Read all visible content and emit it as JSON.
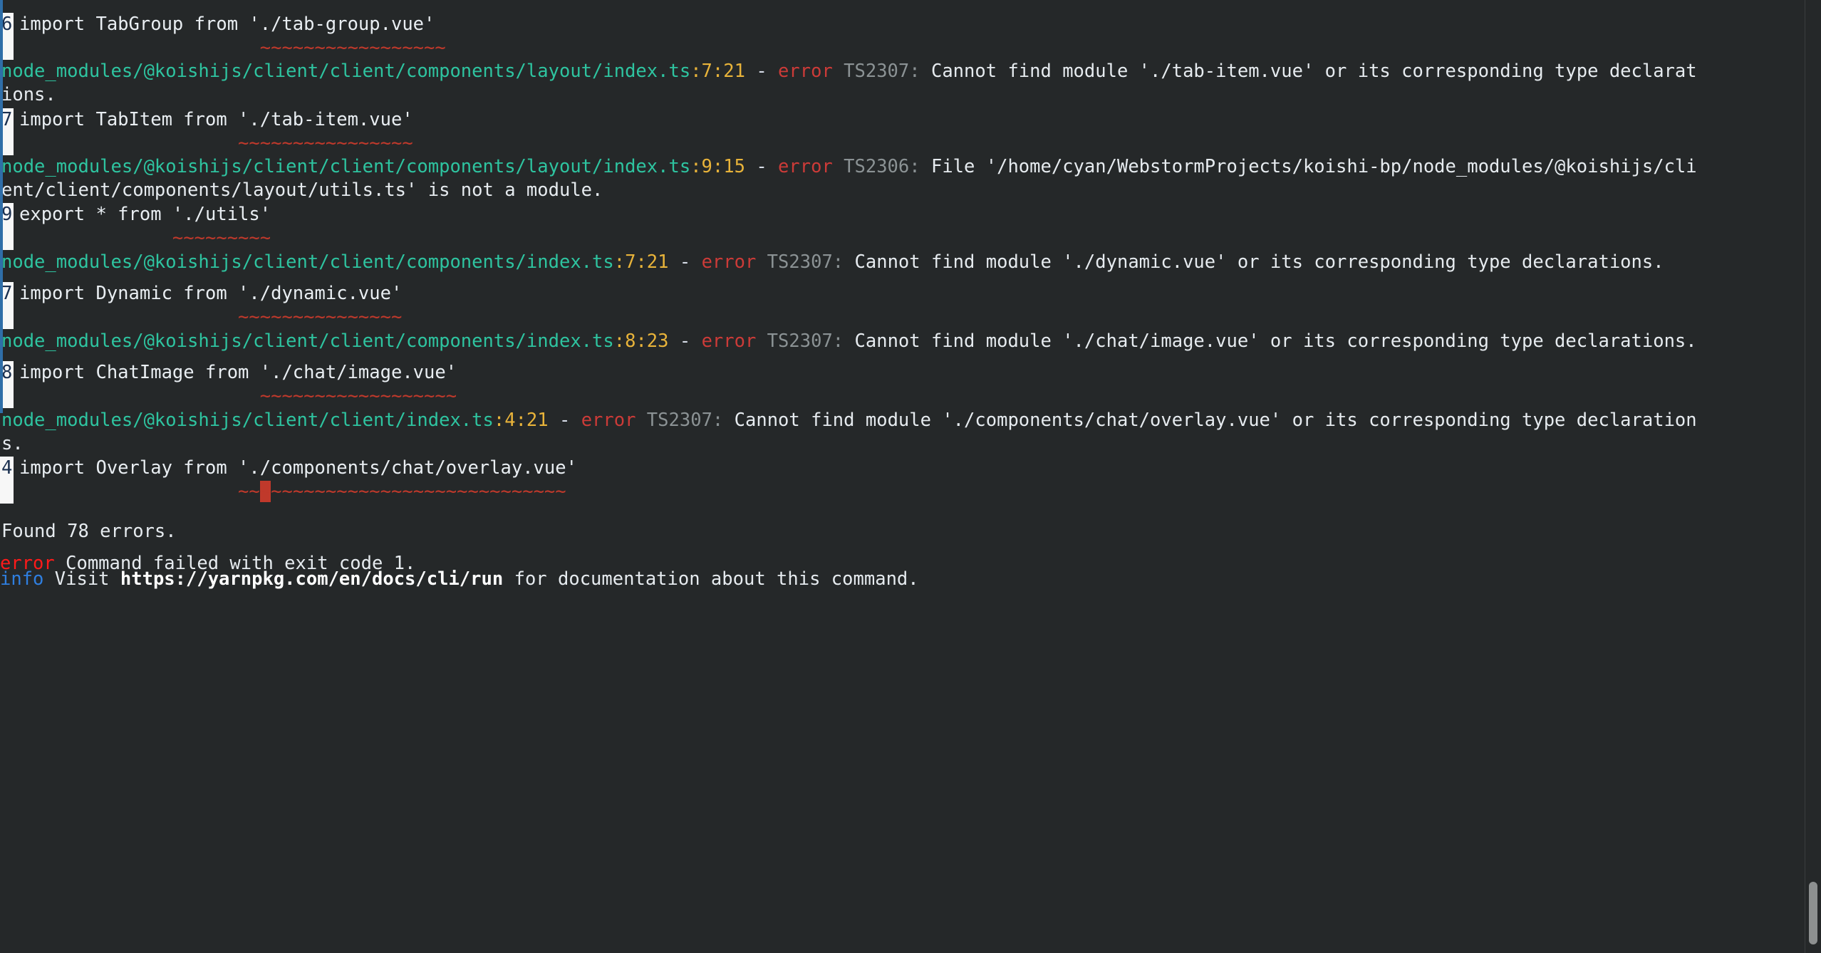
{
  "terminal": {
    "background_color": "#252829",
    "accent_strip_color": "#2f6ea8",
    "colors": {
      "path": "#2ec4a0",
      "position": "#e8b33a",
      "error_word": "#cc3b38",
      "error_code": "#8b9294",
      "message": "#e6ebef",
      "squiggle": "#c0392b",
      "gutter_bg": "#f7f7f7",
      "gutter_fg": "#1b3050",
      "yarn_error_tag": "#ff1a1a",
      "yarn_info_tag": "#2f7fe0"
    }
  },
  "entries": [
    {
      "id": "snippet-0",
      "kind": "snippet",
      "line_number": "6",
      "code": "import TabGroup from './tab-group.vue'",
      "squiggle": "                      ~~~~~~~~~~~~~~~~~",
      "cursor_index": -1
    },
    {
      "id": "diag-1",
      "kind": "diagnostic",
      "path": "node_modules/@koishijs/client/client/components/layout/index.ts",
      "position": ":7:21",
      "dash": " - ",
      "error_word": "error",
      "code": " TS2307:",
      "message": " Cannot find module './tab-item.vue' or its corresponding type declarat",
      "message_wrap": "ions."
    },
    {
      "id": "snippet-1",
      "kind": "snippet",
      "line_number": "7",
      "code": "import TabItem from './tab-item.vue'",
      "squiggle": "                    ~~~~~~~~~~~~~~~~",
      "cursor_index": -1
    },
    {
      "id": "diag-2",
      "kind": "diagnostic",
      "path": "node_modules/@koishijs/client/client/components/layout/index.ts",
      "position": ":9:15",
      "dash": " - ",
      "error_word": "error",
      "code": " TS2306:",
      "message": " File '/home/cyan/WebstormProjects/koishi-bp/node_modules/@koishijs/cli",
      "message_wrap": "ent/client/components/layout/utils.ts' is not a module."
    },
    {
      "id": "snippet-2",
      "kind": "snippet",
      "line_number": "9",
      "code": "export * from './utils'",
      "squiggle": "              ~~~~~~~~~",
      "cursor_index": -1
    },
    {
      "id": "diag-3",
      "kind": "diagnostic",
      "path": "node_modules/@koishijs/client/client/components/index.ts",
      "position": ":7:21",
      "dash": " - ",
      "error_word": "error",
      "code": " TS2307:",
      "message": " Cannot find module './dynamic.vue' or its corresponding type declarations.",
      "message_wrap": ""
    },
    {
      "id": "snippet-3",
      "kind": "snippet",
      "line_number": "7",
      "code": "import Dynamic from './dynamic.vue'",
      "squiggle": "                    ~~~~~~~~~~~~~~~",
      "cursor_index": -1
    },
    {
      "id": "diag-4",
      "kind": "diagnostic",
      "path": "node_modules/@koishijs/client/client/components/index.ts",
      "position": ":8:23",
      "dash": " - ",
      "error_word": "error",
      "code": " TS2307:",
      "message": " Cannot find module './chat/image.vue' or its corresponding type declarations.",
      "message_wrap": ""
    },
    {
      "id": "snippet-4",
      "kind": "snippet",
      "line_number": "8",
      "code": "import ChatImage from './chat/image.vue'",
      "squiggle": "                      ~~~~~~~~~~~~~~~~~~",
      "cursor_index": -1
    },
    {
      "id": "diag-5",
      "kind": "diagnostic",
      "path": "node_modules/@koishijs/client/client/index.ts",
      "position": ":4:21",
      "dash": " - ",
      "error_word": "error",
      "code": " TS2307:",
      "message": " Cannot find module './components/chat/overlay.vue' or its corresponding type declaration",
      "message_wrap": "s."
    },
    {
      "id": "snippet-5",
      "kind": "snippet",
      "line_number": "4",
      "code": "import Overlay from './components/chat/overlay.vue'",
      "squiggle": "                    ~~~~~~~~~~~~~~~~~~~~~~~~~~~~~~",
      "cursor_index": 22
    }
  ],
  "summary": {
    "found_errors": "Found 78 errors."
  },
  "yarn_output": {
    "error_tag": "error",
    "error_message": " Command failed with exit code 1.",
    "info_tag": "info",
    "info_prefix": " Visit ",
    "info_url": "https://yarnpkg.com/en/docs/cli/run",
    "info_suffix": " for documentation about this command."
  }
}
